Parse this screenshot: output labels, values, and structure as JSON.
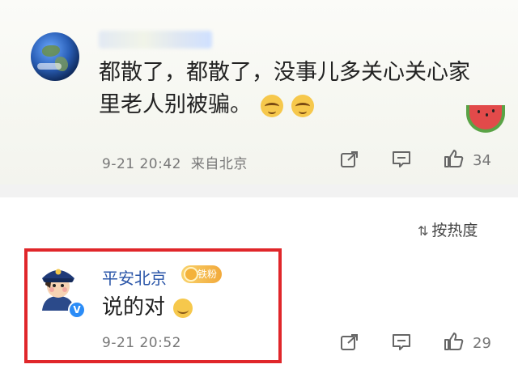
{
  "comments": [
    {
      "text_line1": "都散了，都散了，没事儿多关心关心家",
      "text_line2": "里老人别被骗。",
      "time": "9-21 20:42",
      "location": "来自北京",
      "like_count": "34"
    },
    {
      "author": "平安北京",
      "badge_label": "铁粉",
      "text": "说的对",
      "time": "9-21 20:52",
      "like_count": "29"
    }
  ],
  "sort": {
    "icon": "sort-icon",
    "label": "按热度"
  },
  "colors": {
    "author_link": "#2a55a8",
    "highlight_border": "#e0262a",
    "verified_badge": "#2b8cf7",
    "meta_text": "#777777"
  }
}
